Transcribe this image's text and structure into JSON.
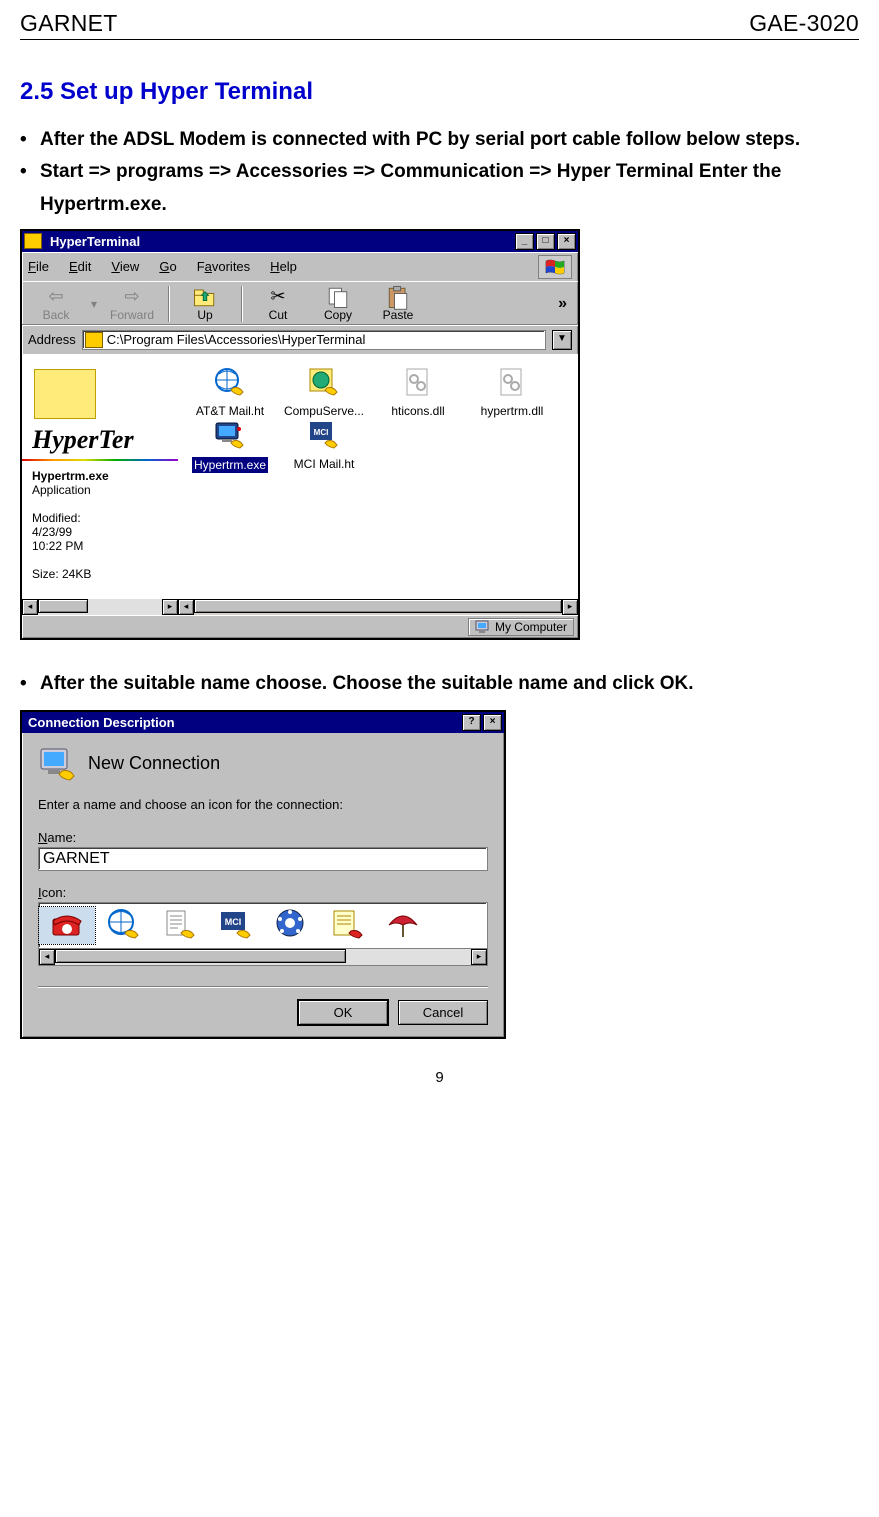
{
  "doc": {
    "header_left": "GARNET",
    "header_right": "GAE-3020",
    "page_number": "9"
  },
  "section_title": "2.5 Set up Hyper Terminal",
  "bullets": [
    "After the ADSL Modem is connected with PC by serial port cable follow below steps.",
    "Start =>  programs => Accessories => Communication => Hyper Terminal Enter the Hypertrm.exe."
  ],
  "explorer": {
    "title": "HyperTerminal",
    "menu": [
      "File",
      "Edit",
      "View",
      "Go",
      "Favorites",
      "Help"
    ],
    "toolbar": {
      "back": {
        "label": "Back",
        "icon": "arrow-left-icon",
        "enabled": false
      },
      "forward": {
        "label": "Forward",
        "icon": "arrow-right-icon",
        "enabled": false
      },
      "up": {
        "label": "Up",
        "icon": "folder-up-icon",
        "enabled": true
      },
      "cut": {
        "label": "Cut",
        "icon": "scissors-icon",
        "enabled": true
      },
      "copy": {
        "label": "Copy",
        "icon": "copy-icon",
        "enabled": true
      },
      "paste": {
        "label": "Paste",
        "icon": "paste-icon",
        "enabled": true
      }
    },
    "address_label": "Address",
    "address_value": "C:\\Program Files\\Accessories\\HyperTerminal",
    "leftpanel": {
      "big_title": "HyperTer",
      "file_name_bold": "Hypertrm.exe",
      "file_type": "Application",
      "modified_label": "Modified:",
      "modified_date": "4/23/99",
      "modified_time": "10:22 PM",
      "size_label": "Size: 24KB"
    },
    "files": [
      {
        "label": "AT&T Mail.ht",
        "icon": "globe-phone-icon"
      },
      {
        "label": "CompuServe...",
        "icon": "cs-globe-icon"
      },
      {
        "label": "hticons.dll",
        "icon": "gear-doc-icon"
      },
      {
        "label": "hypertrm.dll",
        "icon": "gear-doc-icon"
      },
      {
        "label": "Hypertrm.exe",
        "icon": "monitor-phone-icon",
        "selected": true
      },
      {
        "label": "MCI Mail.ht",
        "icon": "mci-icon"
      }
    ],
    "statusbar_text": "My Computer"
  },
  "between_bullet": "After the suitable name choose. Choose the suitable name and click OK.",
  "dialog": {
    "title": "Connection Description",
    "new_connection_label": "New Connection",
    "prompt": "Enter a name and choose an icon for the connection:",
    "name_label": "Name:",
    "name_value": "GARNET",
    "icon_label": "Icon:",
    "icons": [
      "red-phone-icon",
      "globe-phone-icon",
      "doc-phone-icon",
      "mci-icon",
      "dial-icon",
      "note-phone-icon",
      "umbrella-icon"
    ],
    "ok_label": "OK",
    "cancel_label": "Cancel"
  }
}
